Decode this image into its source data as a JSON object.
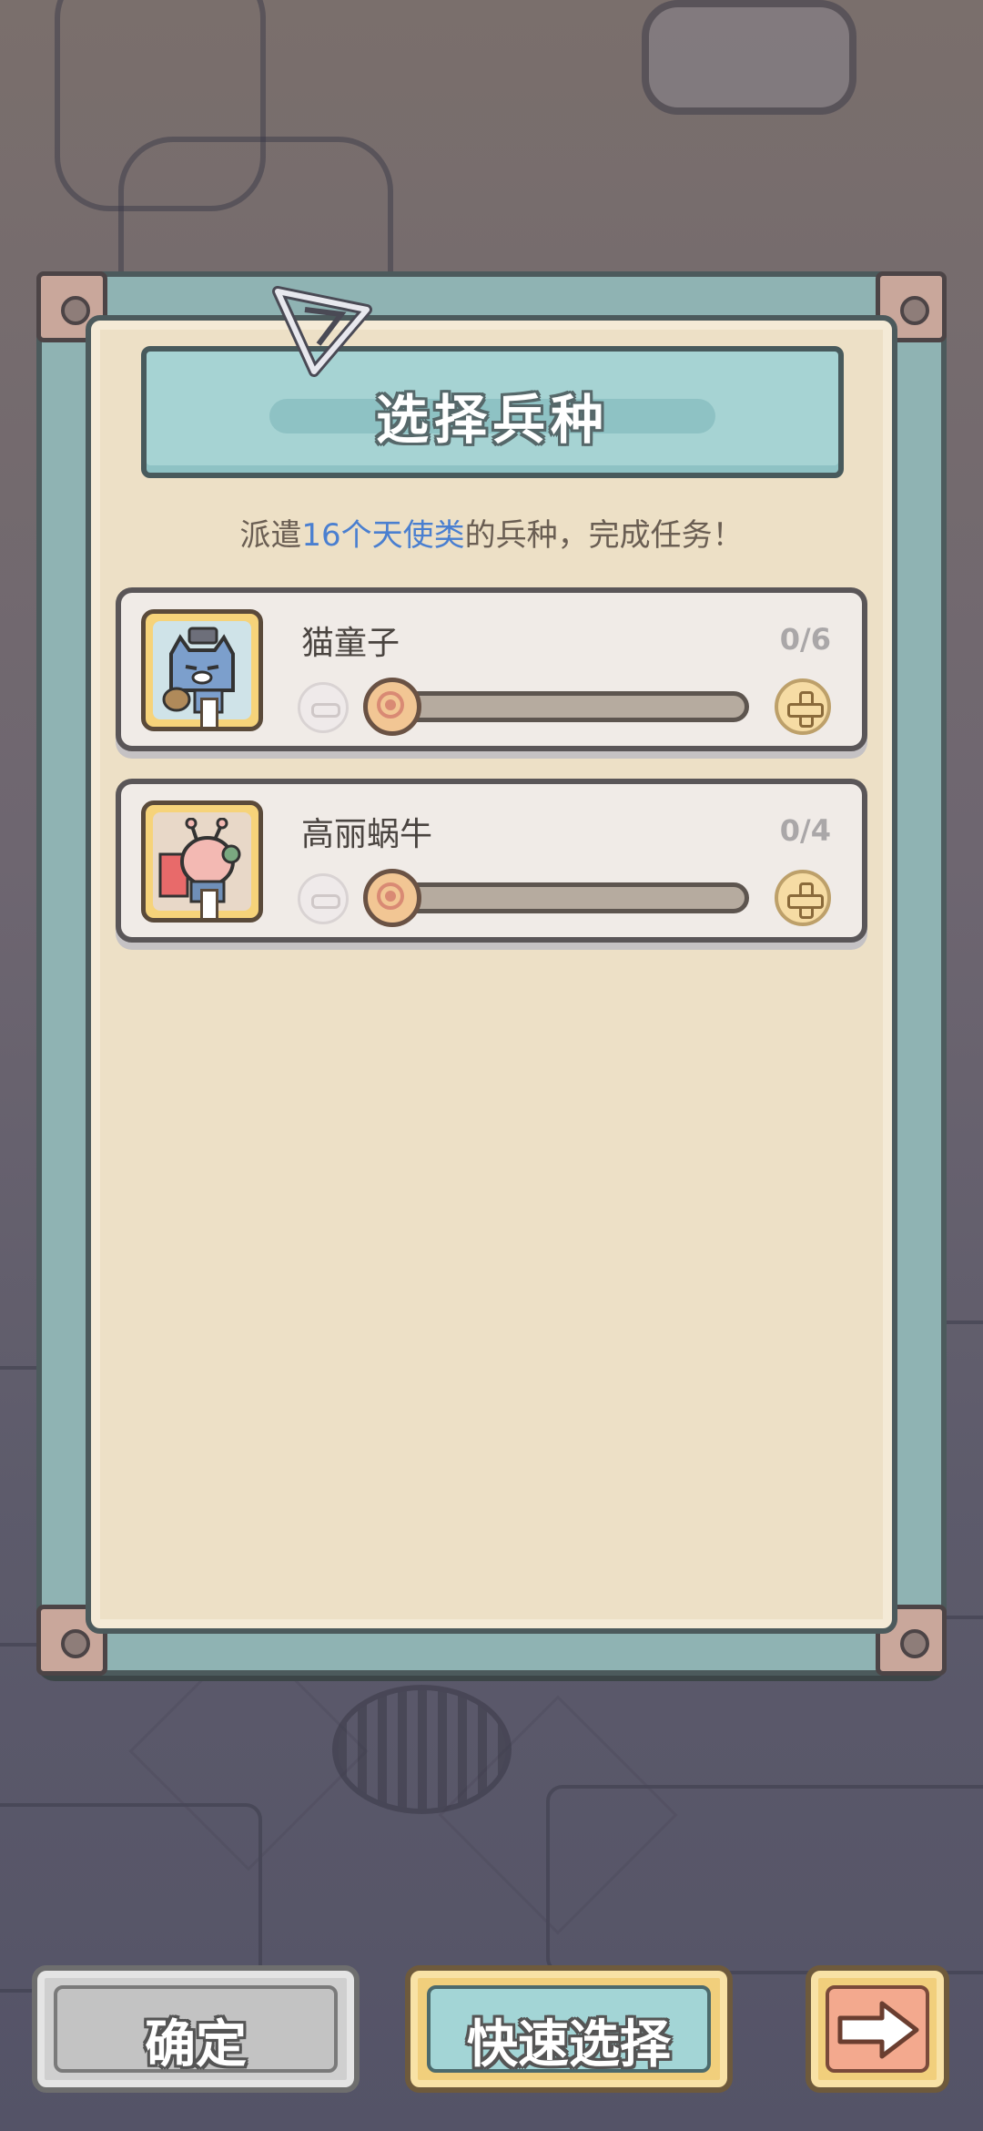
{
  "dialog": {
    "title": "选择兵种",
    "subtitle_prefix": "派遣",
    "subtitle_highlight": "16个天使类",
    "subtitle_suffix": "的兵种，完成任务！"
  },
  "units": [
    {
      "name": "猫童子",
      "count": "0/6",
      "selected": 0,
      "max": 6,
      "portrait_icon": "cat-soldier-icon"
    },
    {
      "name": "高丽蜗牛",
      "count": "0/4",
      "selected": 0,
      "max": 4,
      "portrait_icon": "snail-icon"
    }
  ],
  "buttons": {
    "confirm_label": "确定",
    "quick_select_label": "快速选择",
    "next_icon": "arrow-right-icon"
  },
  "colors": {
    "panel_frame": "#8fb3b3",
    "panel_paper": "#ede0c6",
    "highlight_text": "#4a7fd0",
    "quick_button": "#a3d5d6",
    "next_button": "#f3a98e"
  }
}
